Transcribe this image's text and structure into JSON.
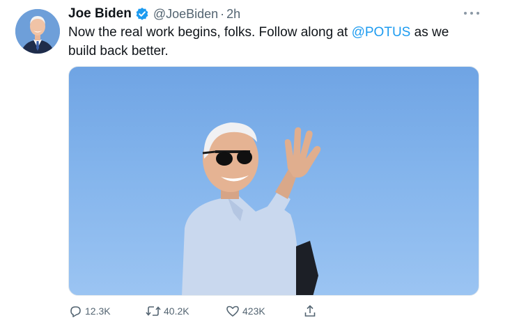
{
  "author": {
    "display_name": "Joe Biden",
    "handle": "@JoeBiden",
    "separator": "·",
    "time": "2h",
    "verified": true
  },
  "tweet": {
    "text_before": "Now the real work begins, folks. Follow along at ",
    "mention": "@POTUS",
    "text_after": " as we build back better."
  },
  "actions": {
    "reply_count": "12.3K",
    "retweet_count": "40.2K",
    "like_count": "423K"
  },
  "icons": [
    "verified-icon",
    "more-icon",
    "reply-icon",
    "retweet-icon",
    "like-icon",
    "share-icon"
  ],
  "colors": {
    "accent": "#1d9bf0",
    "secondary_text": "#536471",
    "sky": "#83b4ec"
  }
}
